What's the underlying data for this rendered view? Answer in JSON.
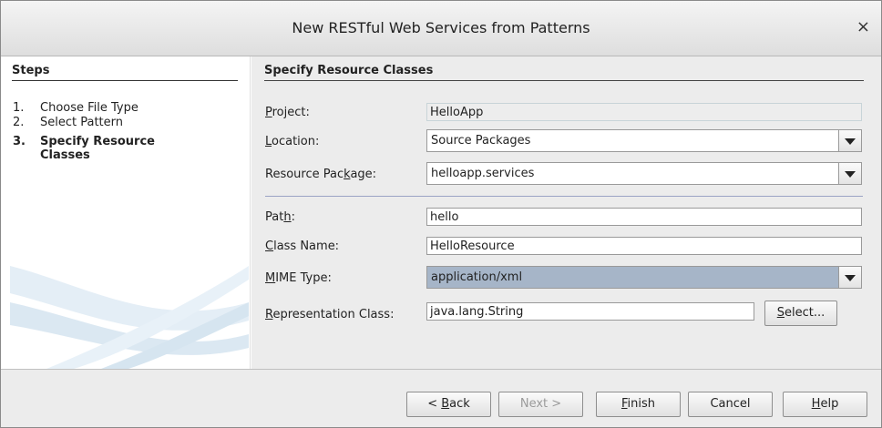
{
  "dialog": {
    "title": "New RESTful Web Services from Patterns",
    "close_glyph": "×"
  },
  "steps": {
    "heading": "Steps",
    "items": [
      {
        "num": "1.",
        "label": "Choose File Type"
      },
      {
        "num": "2.",
        "label": "Select Pattern"
      },
      {
        "num": "3.",
        "label_line1": "Specify Resource",
        "label_line2": "Classes",
        "current": true
      }
    ]
  },
  "form": {
    "heading": "Specify Resource Classes",
    "project": {
      "label_pre": "",
      "label_mnemonic": "P",
      "label_post": "roject:",
      "value": "HelloApp"
    },
    "location": {
      "label_mnemonic": "L",
      "label_post": "ocation:",
      "value": "Source Packages"
    },
    "resource_package": {
      "label_pre": "Resource Pac",
      "label_mnemonic": "k",
      "label_post": "age:",
      "value": "helloapp.services"
    },
    "path": {
      "label_pre": "Pat",
      "label_mnemonic": "h",
      "label_post": ":",
      "value": "hello"
    },
    "class_name": {
      "label_mnemonic": "C",
      "label_post": "lass Name:",
      "value": "HelloResource"
    },
    "mime_type": {
      "label_mnemonic": "M",
      "label_post": "IME Type:",
      "value": "application/xml"
    },
    "representation_class": {
      "label_mnemonic": "R",
      "label_post": "epresentation Class:",
      "value": "java.lang.String"
    },
    "select_button": {
      "mnemonic": "S",
      "post": "elect..."
    }
  },
  "buttons": {
    "back": {
      "pre": "< ",
      "mnemonic": "B",
      "post": "ack"
    },
    "next": "Next >",
    "finish": {
      "mnemonic": "F",
      "post": "inish"
    },
    "cancel": "Cancel",
    "help": {
      "mnemonic": "H",
      "post": "elp"
    }
  }
}
